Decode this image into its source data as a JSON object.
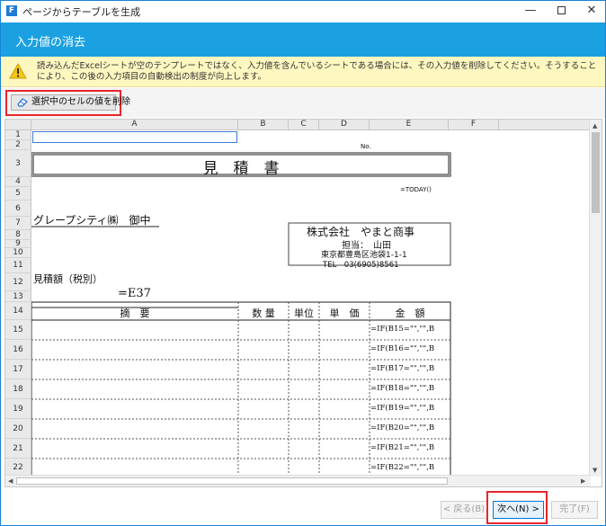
{
  "window": {
    "title": "ページからテーブルを生成",
    "app_icon": "F"
  },
  "header": {
    "title": "入力値の消去"
  },
  "info": {
    "text": "読み込んだExcelシートが空のテンプレートではなく、入力値を含んでいるシートである場合には、その入力値を削除してください。そうすることにより、この後の入力項目の自動検出の制度が向上します。"
  },
  "toolbar": {
    "delete_label": "選択中のセルの値を削除"
  },
  "sheet": {
    "columns": [
      "A",
      "B",
      "C",
      "D",
      "E",
      "F"
    ],
    "rows": [
      "1",
      "2",
      "3",
      "4",
      "5",
      "6",
      "7",
      "8",
      "9",
      "10",
      "11",
      "12",
      "13",
      "14",
      "15",
      "16",
      "17",
      "18",
      "19",
      "20",
      "21",
      "22"
    ],
    "no_label": "No.",
    "doc_title": "見　積　書",
    "today": "=TODAY()",
    "customer": "グレープシティ㈱　御中",
    "company": "株式会社　やまと商事",
    "person": "担当：　山田",
    "address": "東京都豊島区池袋1-1-1",
    "tel": "TEL　03(6905)8561",
    "estimate_label": "見積額（税別）",
    "estimate_value": "=E37",
    "table_headers": {
      "summary": "摘　要",
      "qty": "数 量",
      "unit": "単位",
      "price": "単　価",
      "amount": "金　額"
    },
    "formulas": [
      "=IF(B15=\"\",\"\",B",
      "=IF(B16=\"\",\"\",B",
      "=IF(B17=\"\",\"\",B",
      "=IF(B18=\"\",\"\",B",
      "=IF(B19=\"\",\"\",B",
      "=IF(B20=\"\",\"\",B",
      "=IF(B21=\"\",\"\",B",
      "=IF(B22=\"\",\"\",B"
    ]
  },
  "footer": {
    "back": "< 戻る(B)",
    "next": "次へ(N) >",
    "finish": "完了(F)"
  },
  "colors": {
    "header": "#1ba1e2",
    "highlight": "#e8252c",
    "info_bg": "#fff7c0"
  }
}
